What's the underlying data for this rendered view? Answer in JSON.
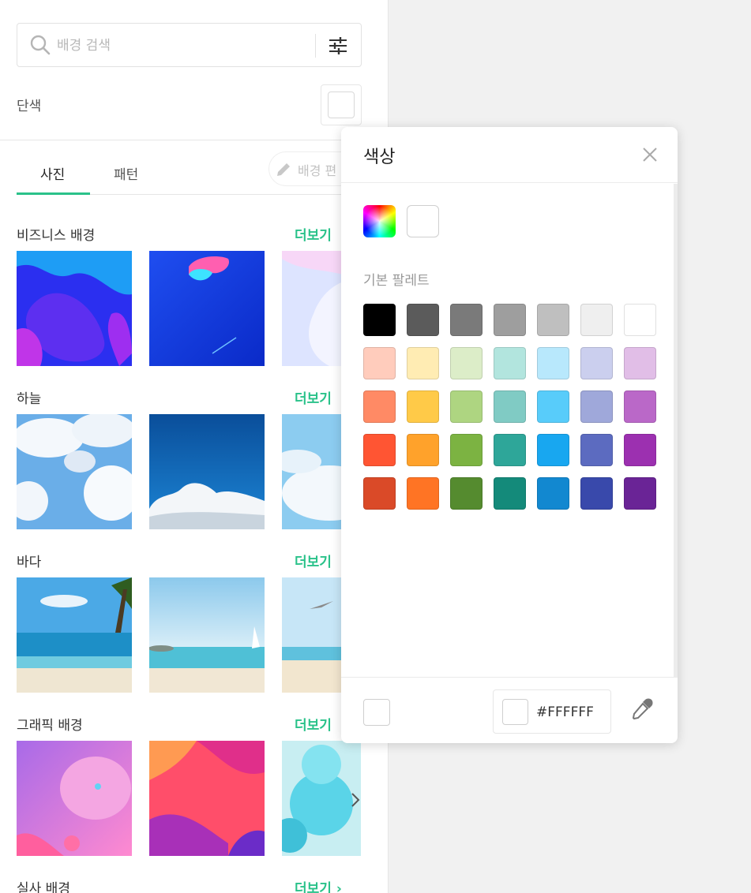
{
  "search": {
    "placeholder": "배경 검색"
  },
  "solid": {
    "label": "단색",
    "color": "#FFFFFF"
  },
  "tabs": [
    {
      "label": "사진",
      "active": true
    },
    {
      "label": "패턴",
      "active": false
    }
  ],
  "edit_button": {
    "label": "배경 편"
  },
  "more_label": "더보기",
  "categories": [
    {
      "title": "비즈니스 배경"
    },
    {
      "title": "하늘"
    },
    {
      "title": "바다"
    },
    {
      "title": "그래픽 배경"
    },
    {
      "title": "실사 배경"
    }
  ],
  "colors": {
    "accent": "#2AC28A"
  },
  "color_picker": {
    "title": "색상",
    "palette_label": "기본 팔레트",
    "palette": [
      [
        "#000000",
        "#5B5B5B",
        "#7A7A7A",
        "#9E9E9E",
        "#BFBFBF",
        "#EFEFEF",
        "#FFFFFF"
      ],
      [
        "#FFCCBC",
        "#FFECB3",
        "#DCEDC8",
        "#B2E5DE",
        "#B8E8FC",
        "#CBCFEE",
        "#E1BEE7"
      ],
      [
        "#FF8A65",
        "#FFCA48",
        "#AED581",
        "#80CBC4",
        "#58CCFA",
        "#9FA8DA",
        "#BA68C8"
      ],
      [
        "#FF5533",
        "#FFA22B",
        "#7CB342",
        "#2EA699",
        "#18A7F0",
        "#5C6BC0",
        "#9C30B0"
      ],
      [
        "#DA4A28",
        "#FF7424",
        "#558B2F",
        "#148A7A",
        "#1288D0",
        "#3949AB",
        "#6A2496"
      ]
    ],
    "hex_value": "#FFFFFF"
  }
}
